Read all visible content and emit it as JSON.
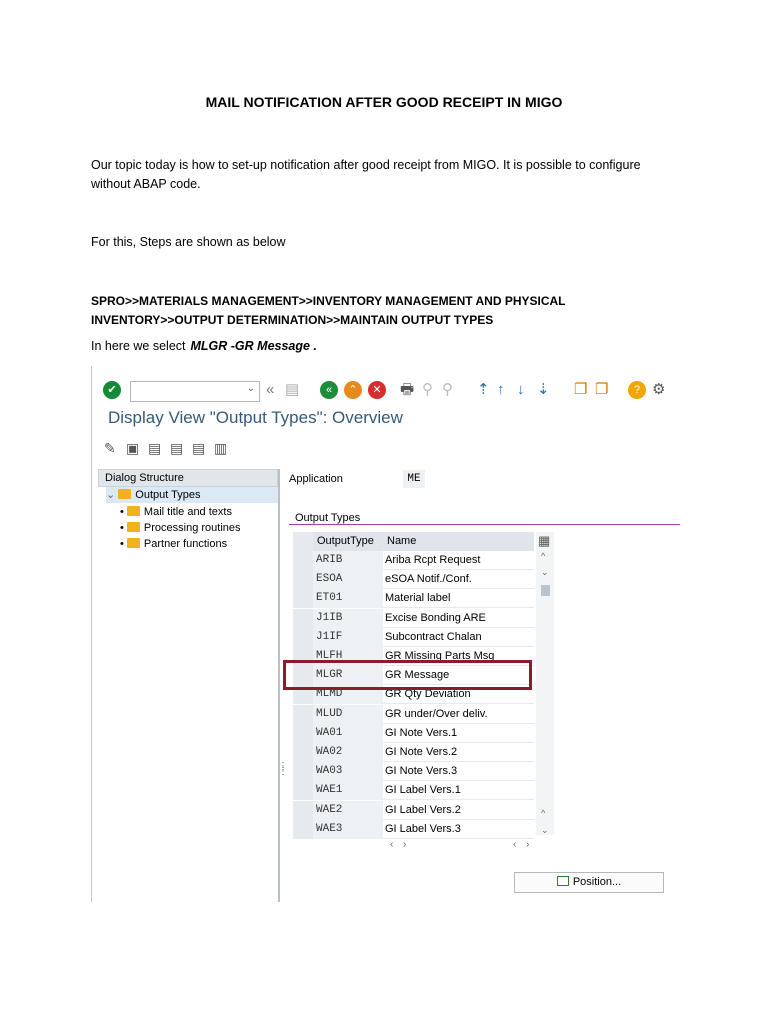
{
  "doc": {
    "title": "MAIL NOTIFICATION AFTER GOOD RECEIPT IN MIGO",
    "paragraph1_line1": "Our topic today  is how to set-up notification after good receipt from  MIGO. It is possible to configure",
    "paragraph1_line2": "without ABAP code.",
    "paragraph2": "For this, Steps are shown as below",
    "path_line1": "SPRO>>MATERIALS MANAGEMENT>>INVENTORY MANAGEMENT AND PHYSICAL",
    "path_line2": "INVENTORY>>OUTPUT DETERMINATION>>MAINTAIN OUTPUT TYPES",
    "select_prefix": "In here we select",
    "select_emphasis": "MLGR -GR Message ."
  },
  "sap": {
    "screen_title": "Display View \"Output Types\": Overview",
    "dialog_structure": {
      "header": "Dialog Structure",
      "root": "Output Types",
      "children": [
        "Mail title and texts",
        "Processing routines",
        "Partner functions"
      ]
    },
    "application_label": "Application",
    "application_value": "ME",
    "output_types_caption": "Output Types",
    "columns": [
      "OutputType",
      "Name"
    ],
    "rows": [
      {
        "code": "ARIB",
        "name": "Ariba Rcpt Request"
      },
      {
        "code": "ESOA",
        "name": "eSOA Notif./Conf."
      },
      {
        "code": "ET01",
        "name": "Material label"
      },
      {
        "code": "J1IB",
        "name": "Excise Bonding ARE"
      },
      {
        "code": "J1IF",
        "name": "Subcontract Chalan"
      },
      {
        "code": "MLFH",
        "name": "GR Missing Parts Msg"
      },
      {
        "code": "MLGR",
        "name": "GR Message"
      },
      {
        "code": "MLMD",
        "name": "GR Qty Deviation"
      },
      {
        "code": "MLUD",
        "name": "GR under/Over deliv."
      },
      {
        "code": "WA01",
        "name": "GI Note Vers.1"
      },
      {
        "code": "WA02",
        "name": "GI Note Vers.2"
      },
      {
        "code": "WA03",
        "name": "GI Note Vers.3"
      },
      {
        "code": "WAE1",
        "name": "GI Label Vers.1"
      },
      {
        "code": "WAE2",
        "name": "GI Label Vers.2"
      },
      {
        "code": "WAE3",
        "name": "GI Label Vers.3"
      }
    ],
    "selected_row": "MLGR",
    "position_button": "Position...",
    "highlight_color": "#8b1c2c",
    "icons": [
      "check-icon",
      "back-icon",
      "save-icon",
      "exit-icon",
      "cancel-icon",
      "print-icon",
      "find-icon",
      "help-icon",
      "settings-icon"
    ]
  }
}
